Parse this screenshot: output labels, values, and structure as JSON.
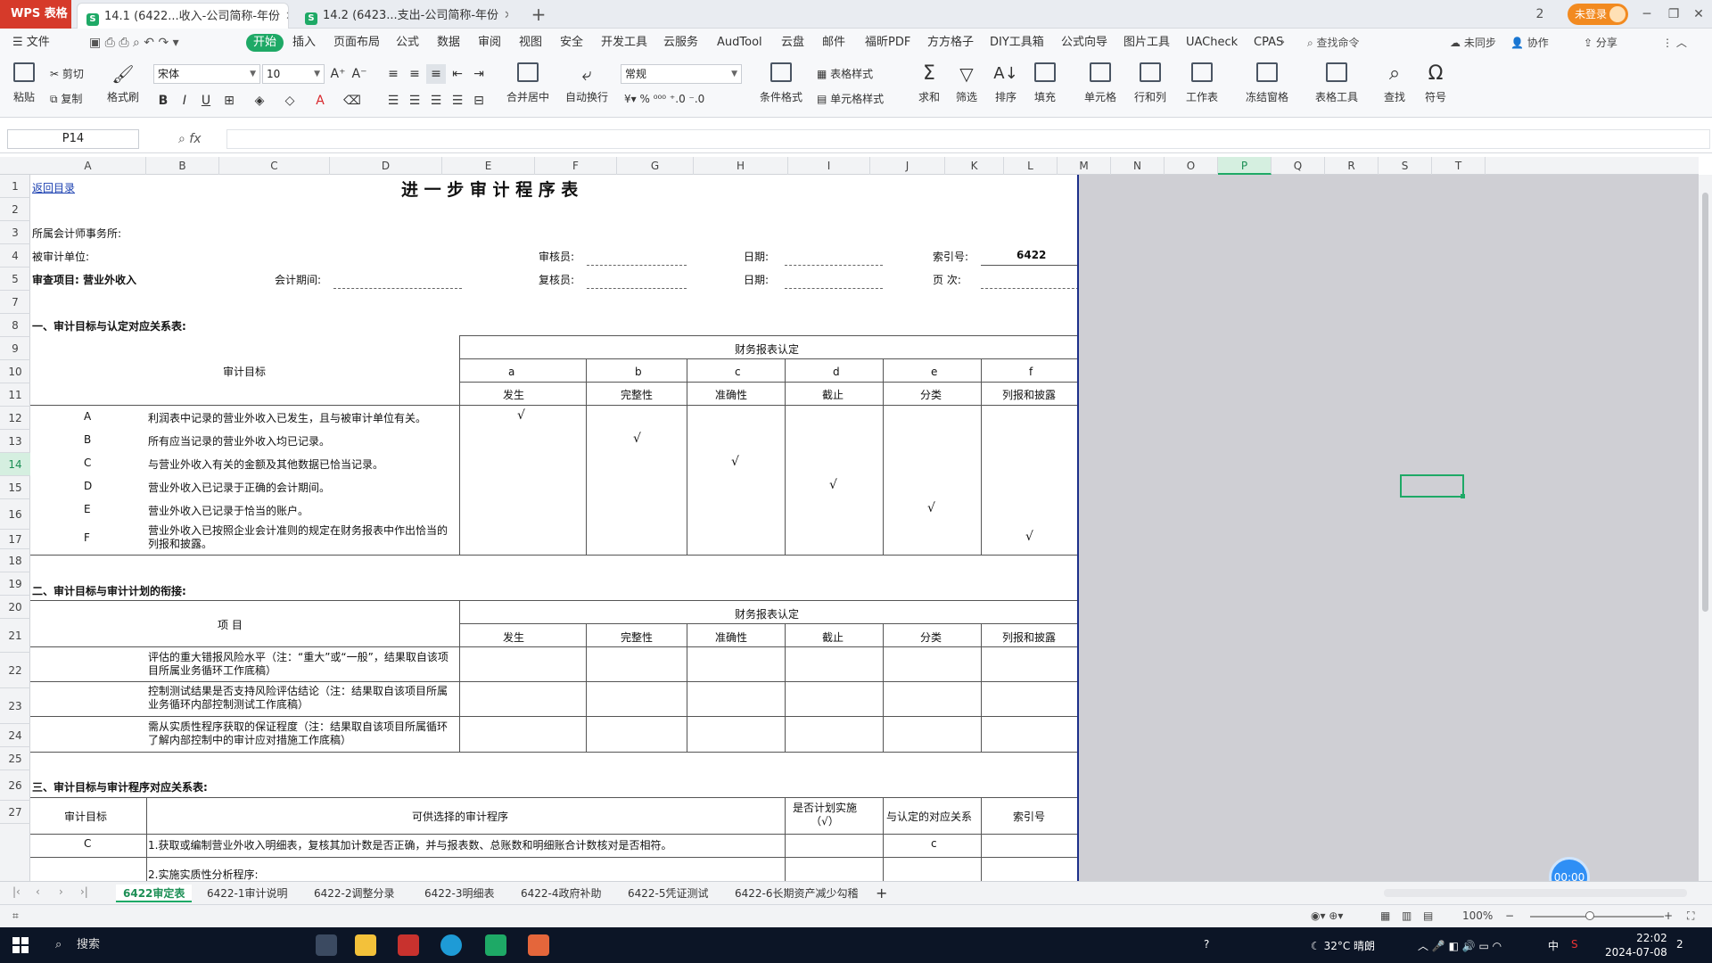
{
  "titlebar": {
    "app_name": "WPS 表格",
    "tabs": [
      {
        "label": "14.1 (6422...收入-公司简称-年份",
        "close": "✕"
      },
      {
        "label": "14.2 (6423...支出-公司简称-年份",
        "close": "✕"
      }
    ],
    "new_tab": "+",
    "login_label": "未登录",
    "window_buttons": [
      "2",
      "─",
      "❐",
      "✕"
    ]
  },
  "menubar": {
    "file_label": "☰ 文件",
    "items": [
      "开始",
      "插入",
      "页面布局",
      "公式",
      "数据",
      "审阅",
      "视图",
      "安全",
      "开发工具",
      "云服务",
      "AudTool",
      "云盘",
      "邮件",
      "福昕PDF",
      "方方格子",
      "DIY工具箱",
      "公式向导",
      "图片工具",
      "UACheck",
      "CPAS"
    ],
    "search_placeholder": "查找命令",
    "right_items": [
      "未同步",
      "协作",
      "分享"
    ]
  },
  "ribbon": {
    "paste": "粘贴",
    "cut": "剪切",
    "copy": "复制",
    "format_painter": "格式刷",
    "font_name": "宋体",
    "font_size": "10",
    "merge_center": "合并居中",
    "auto_wrap": "自动换行",
    "number_format": "常规",
    "table_style": "表格样式",
    "conditional_format": "条件格式",
    "cell_style": "单元格样式",
    "sum": "求和",
    "filter": "筛选",
    "sort": "排序",
    "fill": "填充",
    "cell": "单元格",
    "row_col": "行和列",
    "worksheet": "工作表",
    "freeze": "冻结窗格",
    "table_tools": "表格工具",
    "find": "查找",
    "symbol": "符号"
  },
  "formulabar": {
    "cell_ref": "P14",
    "fx": "fx",
    "formula": ""
  },
  "grid": {
    "columns": [
      "A",
      "B",
      "C",
      "D",
      "E",
      "F",
      "G",
      "H",
      "I",
      "J",
      "K",
      "L",
      "M",
      "N",
      "O",
      "P",
      "Q",
      "R",
      "S",
      "T"
    ],
    "selected_column": "P",
    "rows": [
      "1",
      "2",
      "3",
      "4",
      "5",
      "7",
      "8",
      "9",
      "10",
      "11",
      "12",
      "13",
      "14",
      "15",
      "16",
      "17",
      "18",
      "19",
      "20",
      "21",
      "22",
      "23",
      "24",
      "25",
      "26",
      "27"
    ],
    "selected_row": "14"
  },
  "sheet": {
    "back_link": "返回目录",
    "title": "进 一 步 审 计 程 序 表",
    "firm_label": "所属会计师事务所:",
    "auditee_label": "被审计单位:",
    "reviewer_label": "审核员:",
    "date_label_1": "日期:",
    "index_label": "索引号:",
    "index_value": "6422",
    "item_label": "审查项目: 营业外收入",
    "period_label": "会计期间:",
    "rechecker_label": "复核员:",
    "date_label_2": "日期:",
    "page_label": "页  次:",
    "section1": "一、审计目标与认定对应关系表:",
    "fs_assertion": "财务报表认定",
    "audit_objective": "审计目标",
    "assertion_letters": [
      "a",
      "b",
      "c",
      "d",
      "e",
      "f"
    ],
    "assertion_names": [
      "发生",
      "完整性",
      "准确性",
      "截止",
      "分类",
      "列报和披露"
    ],
    "objectives": [
      {
        "code": "A",
        "text": "利润表中记录的营业外收入已发生，且与被审计单位有关。",
        "tick": "√"
      },
      {
        "code": "B",
        "text": "所有应当记录的营业外收入均已记录。",
        "tick": "√"
      },
      {
        "code": "C",
        "text": "与营业外收入有关的金额及其他数据已恰当记录。",
        "tick": "√"
      },
      {
        "code": "D",
        "text": "营业外收入已记录于正确的会计期间。",
        "tick": "√"
      },
      {
        "code": "E",
        "text": "营业外收入已记录于恰当的账户。",
        "tick": "√"
      },
      {
        "code": "F",
        "text": "营业外收入已按照企业会计准则的规定在财务报表中作出恰当的列报和披露。",
        "tick": "√"
      }
    ],
    "section2": "二、审计目标与审计计划的衔接:",
    "item_header": "项    目",
    "plan_rows": [
      "评估的重大错报风险水平（注：“重大”或“一般”，结果取自该项目所属业务循环工作底稿）",
      "控制测试结果是否支持风险评估结论（注：结果取自该项目所属业务循环内部控制测试工作底稿）",
      "需从实质性程序获取的保证程度（注：结果取自该项目所属循环了解内部控制中的审计应对措施工作底稿）"
    ],
    "section3": "三、审计目标与审计程序对应关系表:",
    "proc_header_objective": "审计目标",
    "proc_header_procedures": "可供选择的审计程序",
    "proc_header_planned": "是否计划实施（√）",
    "proc_header_relation": "与认定的对应关系",
    "proc_header_index": "索引号",
    "proc_rows": [
      {
        "objective": "C",
        "text": "1.获取或编制营业外收入明细表，复核其加计数是否正确，并与报表数、总账数和明细账合计数核对是否相符。",
        "relation": "c"
      },
      {
        "objective": "",
        "text": "2.实施实质性分析程序:",
        "relation": ""
      }
    ]
  },
  "timer": "00:00",
  "sheettabs": [
    "6422审定表",
    "6422-1审计说明",
    "6422-2调整分录",
    "6422-3明细表",
    "6422-4政府补助",
    "6422-5凭证测试",
    "6422-6长期资产减少勾稽"
  ],
  "statusbar": {
    "zoom": "100%"
  },
  "taskbar": {
    "search_label": "搜索",
    "weather": "32°C 晴朗",
    "ime": "中",
    "time": "22:02",
    "date": "2024-07-08",
    "notif_count": "2"
  }
}
